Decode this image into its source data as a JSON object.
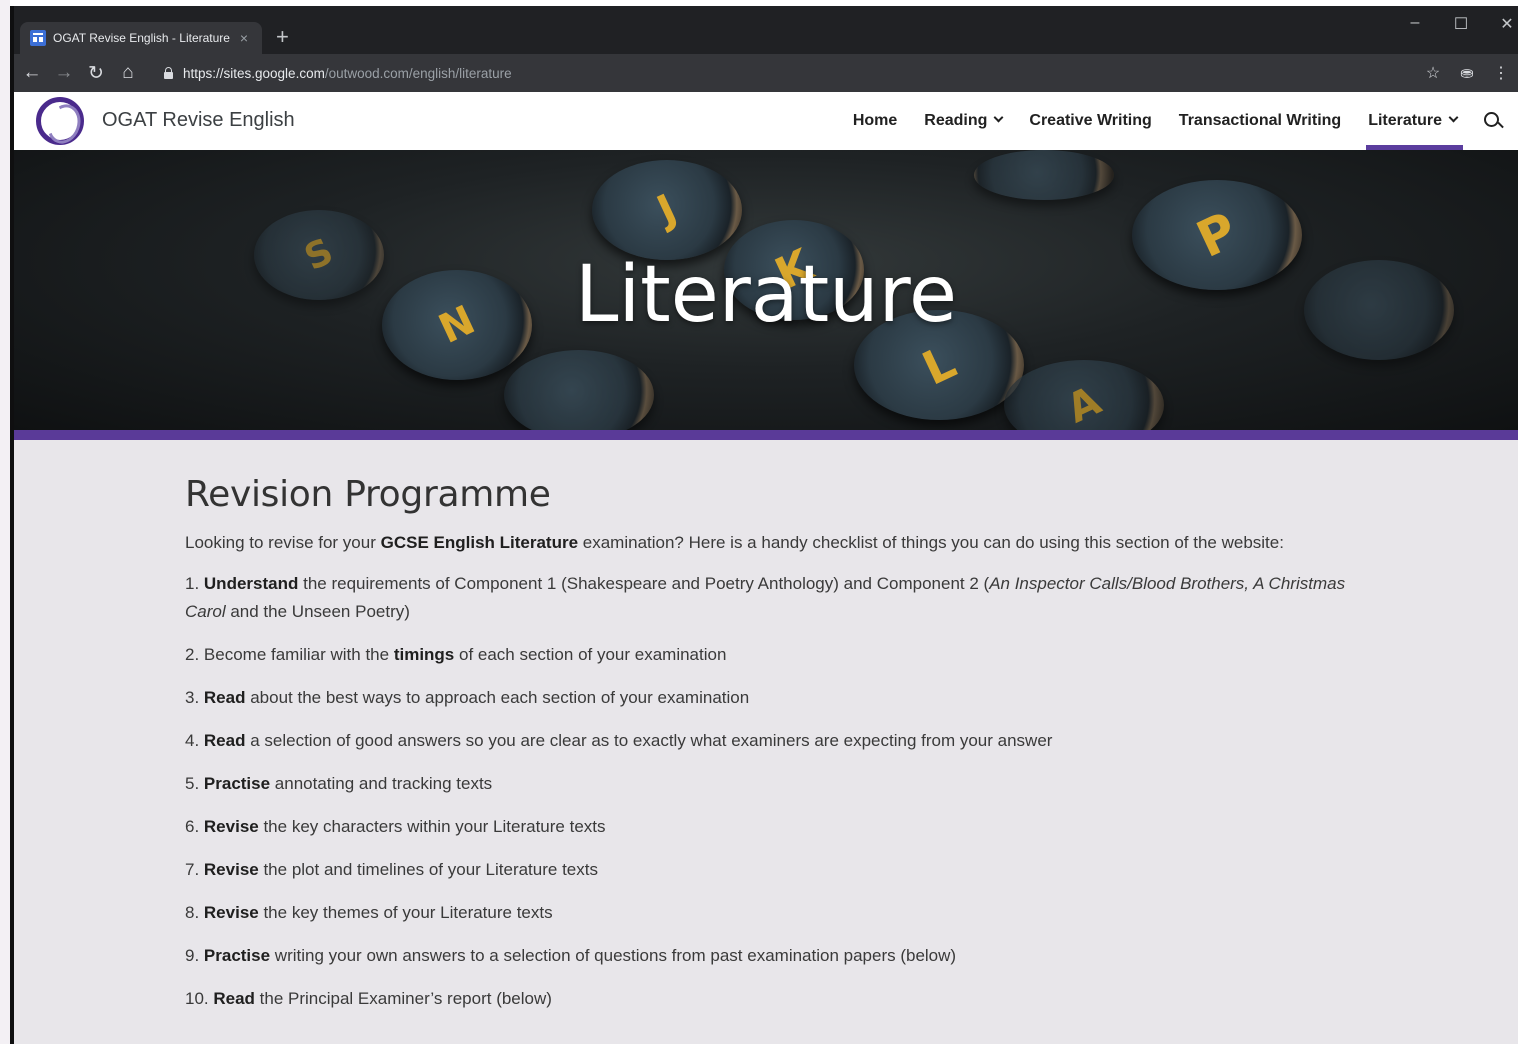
{
  "browser": {
    "tab_title": "OGAT Revise English - Literature",
    "tab_close": "×",
    "new_tab": "+",
    "window_controls": {
      "minimize": "–",
      "maximize": "☐",
      "close": "✕"
    },
    "url_host": "https://sites.google.com",
    "url_path": "/outwood.com/english/literature",
    "icons": [
      "back-icon",
      "forward-icon",
      "reload-icon",
      "home-icon",
      "lock-icon",
      "star-icon",
      "incognito-icon",
      "menu-icon"
    ]
  },
  "site": {
    "title": "OGAT Revise English",
    "nav": {
      "home": "Home",
      "reading": "Reading",
      "creative_writing": "Creative Writing",
      "transactional_writing": "Transactional Writing",
      "literature": "Literature"
    },
    "accent_color": "#5a3a98"
  },
  "hero": {
    "title": "Literature",
    "keys": [
      "J",
      "K",
      "P",
      "N",
      "L",
      "S",
      "A"
    ]
  },
  "content": {
    "heading": "Revision Programme",
    "intro": {
      "pre": "Looking to revise for your ",
      "bold": "GCSE English Literature",
      "post": " examination? Here is a handy checklist of things you can do using this section of the website:"
    },
    "item1": {
      "num": "1. ",
      "bold": "Understand",
      "text_a": " the requirements of Component 1 (Shakespeare and Poetry Anthology) and Component 2 (",
      "italic_a": "An Inspector Calls/Blood Brothers, A Christmas Carol",
      "text_b": " and the Unseen Poetry)"
    },
    "item2": {
      "num": "2. ",
      "pre": "Become familiar with the ",
      "bold": "timings",
      "post": " of each section of your examination"
    },
    "items": [
      {
        "num": "3. ",
        "bold": "Read",
        "text": " about the best ways to approach each section of your examination"
      },
      {
        "num": "4. ",
        "bold": "Read",
        "text": " a selection of good answers so you are clear as to exactly what examiners are expecting from your answer"
      },
      {
        "num": "5. ",
        "bold": "Practise",
        "text": " annotating and tracking texts"
      },
      {
        "num": "6. ",
        "bold": "Revise",
        "text": " the key characters within your Literature texts"
      },
      {
        "num": "7. ",
        "bold": "Revise",
        "text": " the plot and timelines of your Literature texts"
      },
      {
        "num": "8. ",
        "bold": "Revise",
        "text": " the key themes of your Literature texts"
      },
      {
        "num": "9. ",
        "bold": "Practise",
        "text": " writing your own answers to a selection of questions from past examination papers (below)"
      },
      {
        "num": "10. ",
        "bold": "Read",
        "text": " the Principal Examiner’s report (below)"
      }
    ]
  }
}
